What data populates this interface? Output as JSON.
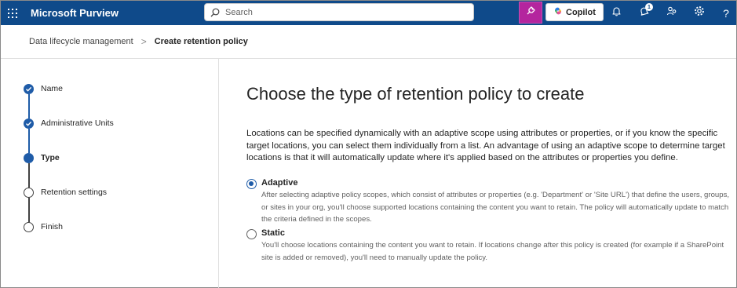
{
  "header": {
    "app_title": "Microsoft Purview",
    "search_placeholder": "Search",
    "copilot_label": "Copilot",
    "notification_count": "1",
    "help_glyph": "?",
    "icons": [
      "waffle-icon",
      "search-icon",
      "pink-action-icon",
      "copilot-logo-icon",
      "bell-icon",
      "notification-bell-icon",
      "people-icon",
      "gear-icon",
      "help-icon"
    ]
  },
  "breadcrumb": {
    "parent": "Data lifecycle management",
    "separator": ">",
    "current": "Create retention policy"
  },
  "steps": [
    {
      "label": "Name",
      "state": "done"
    },
    {
      "label": "Administrative Units",
      "state": "done"
    },
    {
      "label": "Type",
      "state": "current"
    },
    {
      "label": "Retention settings",
      "state": "todo"
    },
    {
      "label": "Finish",
      "state": "todo"
    }
  ],
  "main": {
    "title": "Choose the type of retention policy to create",
    "description": "Locations can be specified dynamically with an adaptive scope using attributes or properties, or if you know the specific target locations, you can select them individually from a list. An advantage of using an adaptive scope to determine target locations is that it will automatically update where it's applied based on the attributes or properties you define.",
    "options": [
      {
        "label": "Adaptive",
        "selected": true,
        "description": "After selecting adaptive policy scopes, which consist of attributes or properties (e.g. 'Department' or 'Site URL') that define the users, groups, or sites in your org, you'll choose supported locations containing the content you want to retain. The policy will automatically update to match the criteria defined in the scopes."
      },
      {
        "label": "Static",
        "selected": false,
        "description": "You'll choose locations containing the content you want to retain. If locations change after this policy is created (for example if a SharePoint site is added or removed), you'll need to manually update the policy."
      }
    ]
  },
  "colors": {
    "topbar": "#0f4a8a",
    "accent": "#1f5ca8",
    "pink_button": "#b4259e"
  }
}
